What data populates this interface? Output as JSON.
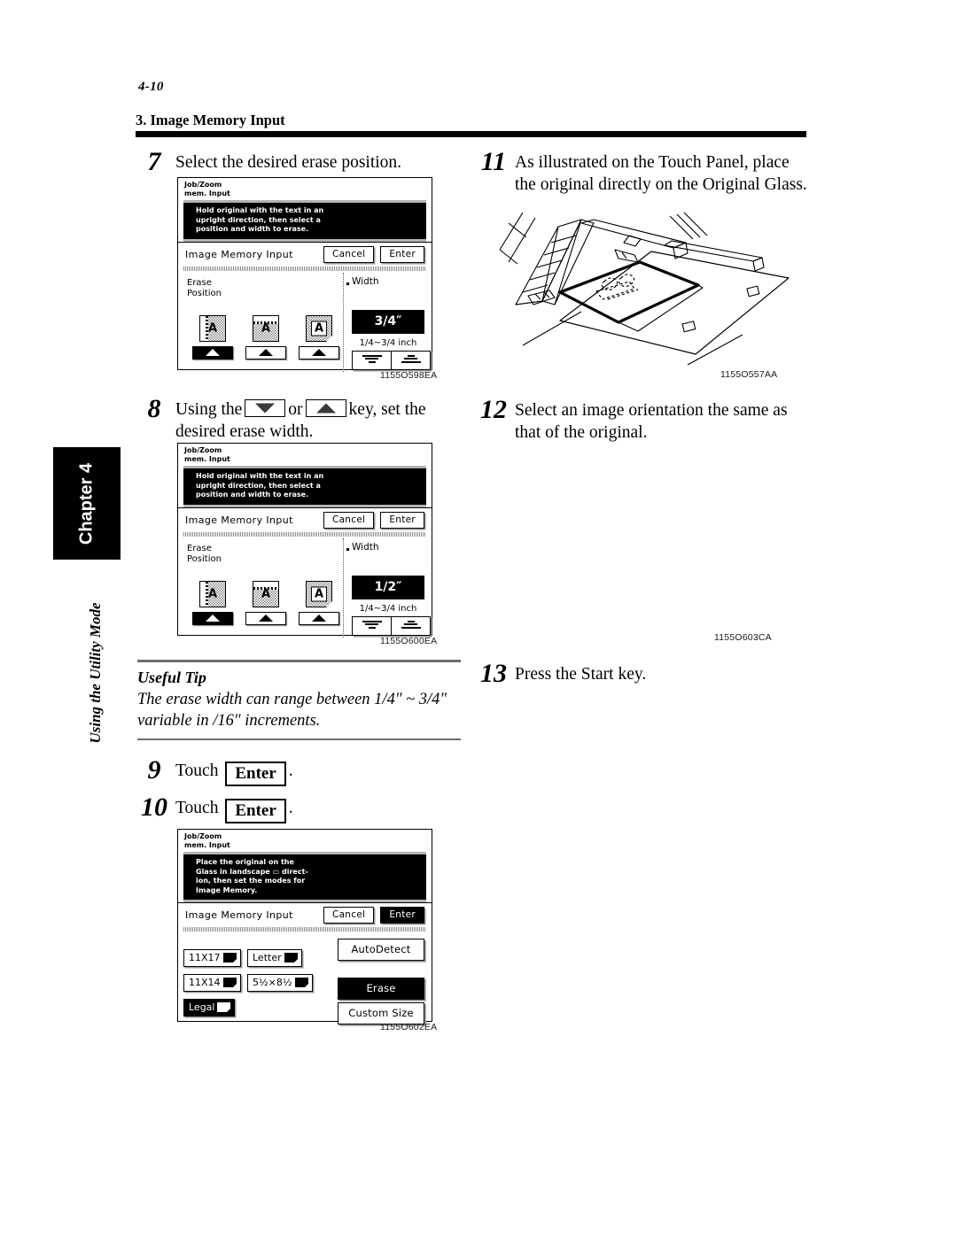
{
  "page": {
    "number": "4-10",
    "section_title": "3. Image Memory Input",
    "chapter_tab": "Chapter 4",
    "chapter_subtitle": "Using the Utility Mode"
  },
  "steps": {
    "s7": {
      "num": "7",
      "text": "Select the desired erase position."
    },
    "s8": {
      "num": "8",
      "text_before": "Using the",
      "text_middle": "or",
      "text_after": "key, set the",
      "text_line2": "desired erase width."
    },
    "s9": {
      "num": "9",
      "text_before": "Touch",
      "button": "Enter",
      "text_after": "."
    },
    "s10": {
      "num": "10",
      "text_before": "Touch",
      "button": "Enter",
      "text_after": "."
    },
    "s11": {
      "num": "11",
      "text": "As illustrated on the Touch Panel, place the original directly on the Original Glass."
    },
    "s12": {
      "num": "12",
      "text": "Select an image orientation the same as that of the original."
    },
    "s13": {
      "num": "13",
      "text": "Press the Start key."
    }
  },
  "useful_tip": {
    "heading": "Useful Tip",
    "body": "The erase width can range between 1/4″ ~ 3/4″ variable in /16″ increments."
  },
  "lcd_erase_position": {
    "header": "Job/Zoom\nmem. Input",
    "message": "Hold original with the text in an\nupright direction, then select a\nposition and width to erase.",
    "screen_title": "Image Memory Input",
    "cancel_label": "Cancel",
    "enter_label": "Enter",
    "erase_label": "Erase\nPosition",
    "width_label": "Width",
    "width_value": "3/4″",
    "width_range": "1/4~3/4 inch",
    "position_keys": [
      {
        "name": "left-edge-erase",
        "letter": "A",
        "selected": true
      },
      {
        "name": "top-edge-erase",
        "letter": "A",
        "selected": false
      },
      {
        "name": "frame-erase",
        "letter": "A",
        "selected": false
      }
    ],
    "fig_code": "1155O598EA"
  },
  "lcd_erase_width": {
    "header": "Job/Zoom\nmem. Input",
    "message": "Hold original with the text in an\nupright direction, then select a\nposition and width to erase.",
    "screen_title": "Image Memory Input",
    "cancel_label": "Cancel",
    "enter_label": "Enter",
    "erase_label": "Erase\nPosition",
    "width_label": "Width",
    "width_value": "1/2″",
    "width_range": "1/4~3/4 inch",
    "position_keys": [
      {
        "name": "left-edge-erase",
        "letter": "A",
        "selected": true
      },
      {
        "name": "top-edge-erase",
        "letter": "A",
        "selected": false
      },
      {
        "name": "frame-erase",
        "letter": "A",
        "selected": false
      }
    ],
    "fig_code": "1155O600EA"
  },
  "lcd_paper_size": {
    "header": "Job/Zoom\nmem. Input",
    "message": "Place the original on the\nGlass in landscape ▭ direct-\nion, then set the modes for\nImage Memory.",
    "screen_title": "Image Memory Input",
    "cancel_label": "Cancel",
    "enter_label": "Enter",
    "enter_selected": true,
    "sizes": [
      {
        "label": "11X17",
        "selected": false
      },
      {
        "label": "Letter",
        "selected": false
      },
      {
        "label": "11X14",
        "selected": false
      },
      {
        "label": "5½×8½",
        "selected": false
      },
      {
        "label": "Legal",
        "selected": true
      }
    ],
    "auto_detect_label": "AutoDetect",
    "erase_label": "Erase",
    "erase_selected": true,
    "custom_size_label": "Custom Size",
    "fig_code": "1155O602EA"
  },
  "illustration_original_glass": {
    "caption": "Copier with document feeder raised and original placed face-down on the Original Glass",
    "fig_code": "1155O557AA"
  },
  "illustration_orientation": {
    "fig_code": "1155O603CA"
  }
}
